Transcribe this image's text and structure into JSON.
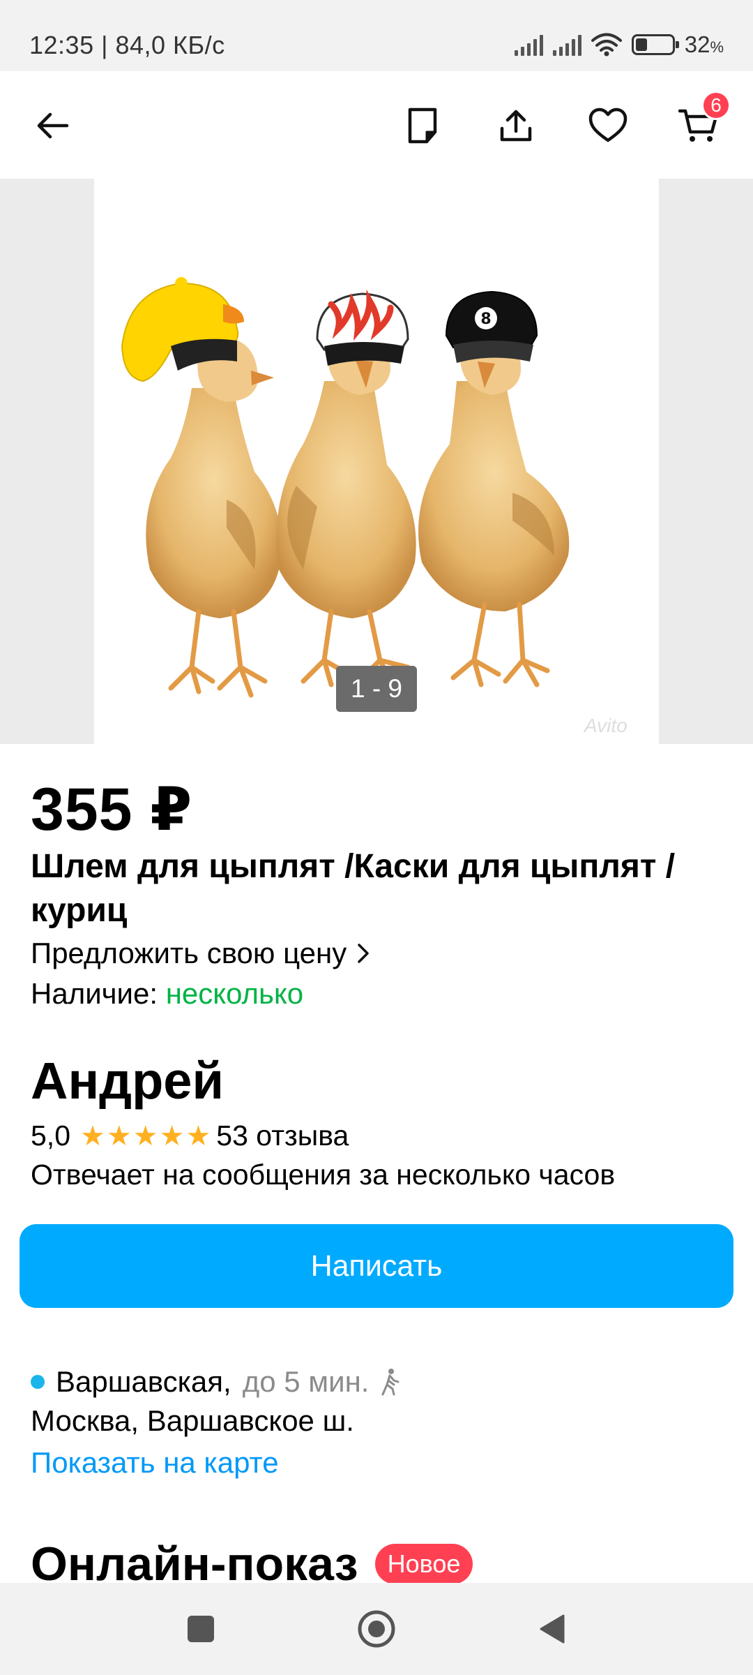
{
  "status_bar": {
    "time_speed": "12:35 | 84,0 КБ/с",
    "battery_percent": "32",
    "battery_unit": "%",
    "battery_level": 0.32
  },
  "app_bar": {
    "icons": [
      "back-arrow-icon",
      "note-icon",
      "share-icon",
      "heart-icon",
      "cart-icon"
    ],
    "cart_badge": "6"
  },
  "gallery": {
    "counter": "1 - 9",
    "watermark": "Avito"
  },
  "listing": {
    "price": "355 ₽",
    "title": "Шлем для цыплят /Каски для цыплят / куриц",
    "offer_price_label": "Предложить свою цену",
    "availability_label": "Наличие:",
    "availability_value": "несколько"
  },
  "seller": {
    "name": "Андрей",
    "rating": "5,0",
    "stars": 5,
    "reviews": "53 отзыва",
    "response_note": "Отвечает на сообщения за несколько часов"
  },
  "actions": {
    "write_button": "Написать"
  },
  "location": {
    "metro_station": "Варшавская,",
    "metro_time": "до 5 мин.",
    "metro_color": "#1bb5ec",
    "address": "Москва, Варшавское ш.",
    "map_link": "Показать на карте"
  },
  "online_show": {
    "title": "Онлайн-показ",
    "badge": "Новое"
  },
  "colors": {
    "accent": "#00aaff",
    "link": "#0099f7",
    "success": "#02b345",
    "badge": "#ff4053",
    "star": "#ffb021"
  }
}
